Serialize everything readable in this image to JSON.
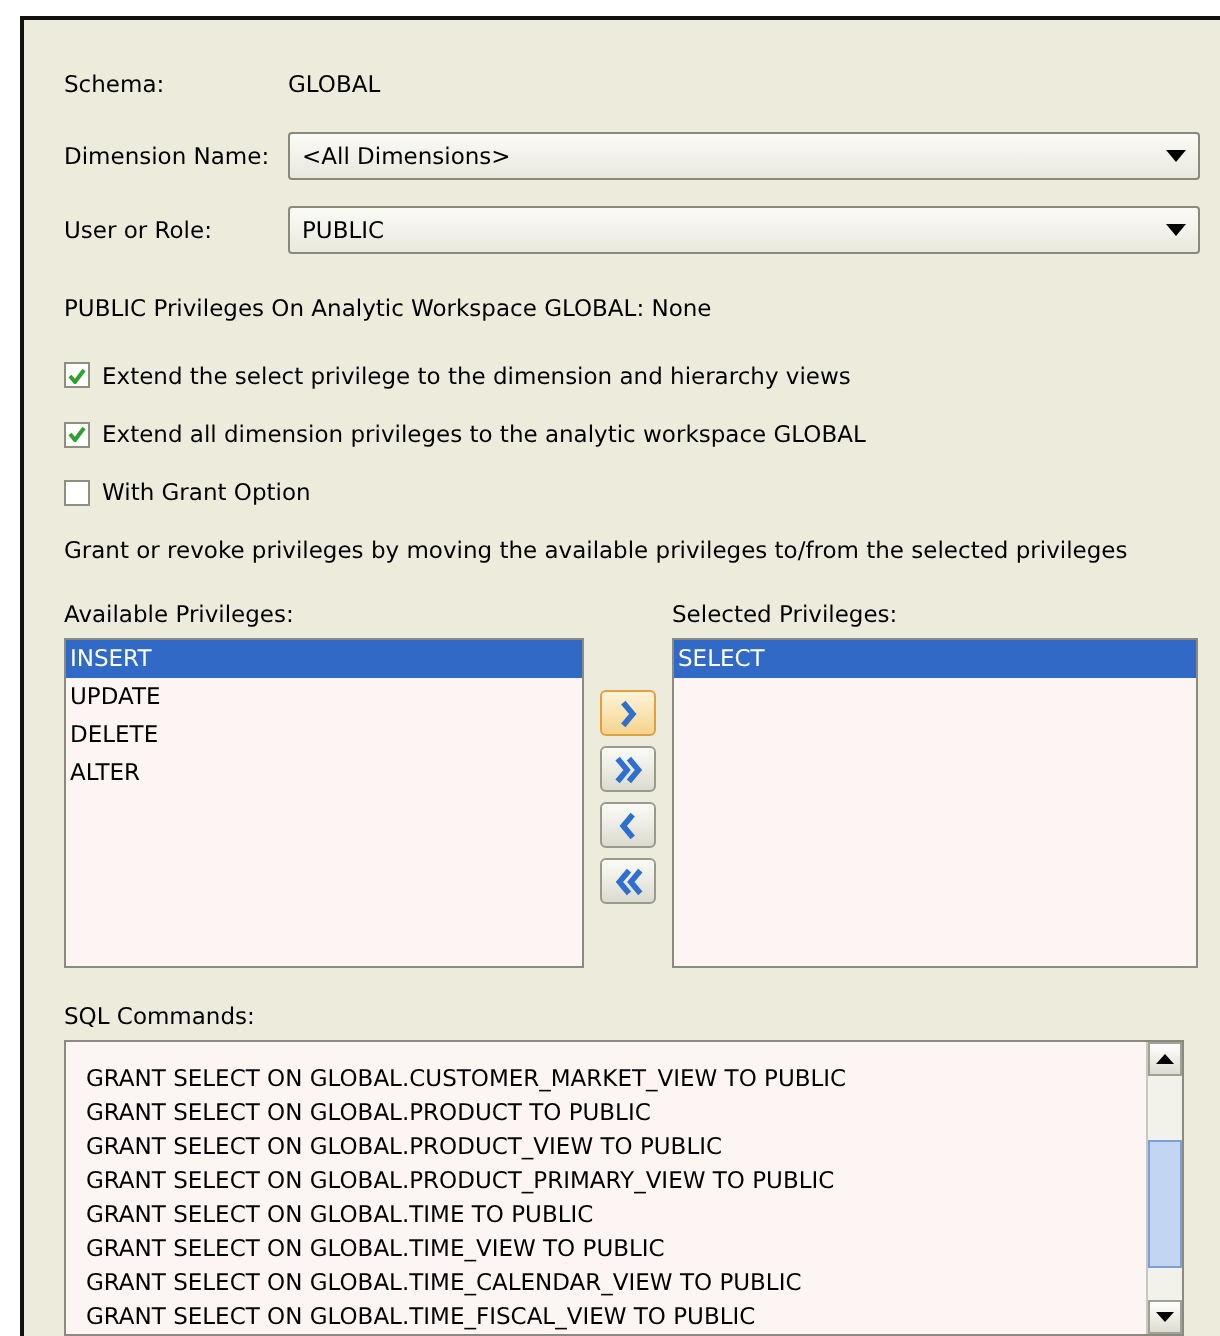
{
  "schema": {
    "label": "Schema:",
    "value": "GLOBAL"
  },
  "fields": [
    {
      "label": "Dimension Name:",
      "value": "<All Dimensions>"
    },
    {
      "label": "User or Role:",
      "value": "PUBLIC"
    }
  ],
  "privileges_summary": "PUBLIC Privileges On Analytic Workspace GLOBAL:  None",
  "options": [
    {
      "label": "Extend the select privilege to the dimension and hierarchy views",
      "checked": true
    },
    {
      "label": "Extend all dimension privileges to the analytic workspace GLOBAL",
      "checked": true
    },
    {
      "label": "With Grant Option",
      "checked": false
    }
  ],
  "instructions": "Grant or revoke privileges by moving the available privileges to/from the selected privileges",
  "available": {
    "label": "Available Privileges:",
    "items": [
      {
        "text": "INSERT",
        "selected": true
      },
      {
        "text": "UPDATE",
        "selected": false
      },
      {
        "text": "DELETE",
        "selected": false
      },
      {
        "text": "ALTER",
        "selected": false
      }
    ]
  },
  "move_buttons": [
    {
      "kind": "add",
      "focused": true
    },
    {
      "kind": "add_all",
      "focused": false
    },
    {
      "kind": "remove",
      "focused": false
    },
    {
      "kind": "remove_all",
      "focused": false
    }
  ],
  "selected": {
    "label": "Selected Privileges:",
    "items": [
      {
        "text": "SELECT",
        "selected": true
      }
    ]
  },
  "sql": {
    "label": "SQL Commands:",
    "lines": [
      "GRANT SELECT ON GLOBAL.CUSTOMER_MARKET_VIEW TO PUBLIC",
      "GRANT SELECT ON GLOBAL.PRODUCT TO PUBLIC",
      "GRANT SELECT ON GLOBAL.PRODUCT_VIEW TO PUBLIC",
      "GRANT SELECT ON GLOBAL.PRODUCT_PRIMARY_VIEW TO PUBLIC",
      "GRANT SELECT ON GLOBAL.TIME TO PUBLIC",
      "GRANT SELECT ON GLOBAL.TIME_VIEW TO PUBLIC",
      "GRANT SELECT ON GLOBAL.TIME_CALENDAR_VIEW TO PUBLIC",
      "GRANT SELECT ON GLOBAL.TIME_FISCAL_VIEW TO PUBLIC"
    ]
  }
}
